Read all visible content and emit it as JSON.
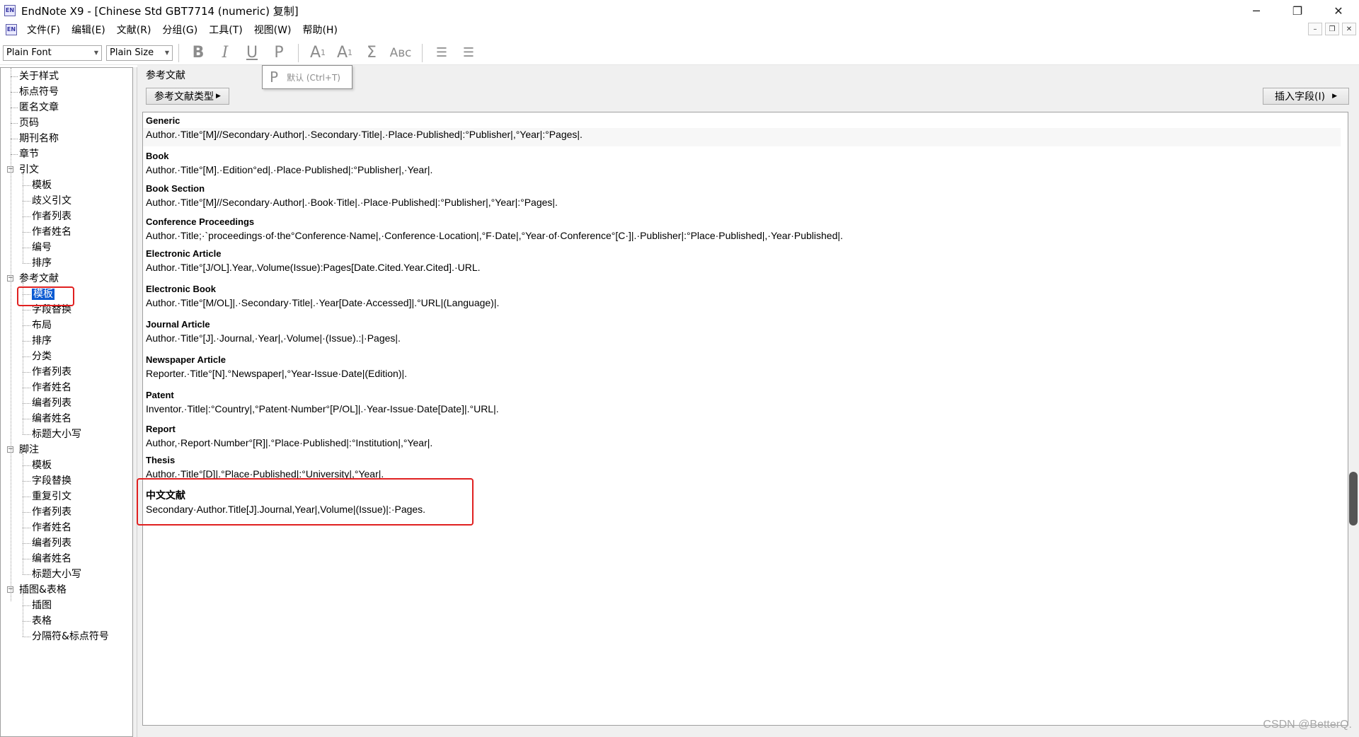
{
  "window": {
    "app_icon": "EN",
    "title": "EndNote X9 - [Chinese Std GBT7714 (numeric) 复制]"
  },
  "menu": {
    "items": [
      "文件(F)",
      "编辑(E)",
      "文献(R)",
      "分组(G)",
      "工具(T)",
      "视图(W)",
      "帮助(H)"
    ]
  },
  "toolbar": {
    "font_combo": "Plain Font",
    "size_combo": "Plain Size",
    "bold": "B",
    "italic": "I",
    "underline": "U",
    "plain": "P",
    "superscript": "A",
    "superscript_mark": "1",
    "subscript": "A",
    "subscript_mark": "1",
    "symbol": "Σ",
    "small_caps": "Aʙᴄ",
    "tooltip_icon": "P",
    "tooltip_text": "默认 (Ctrl+T)"
  },
  "tree": {
    "items": [
      "关于样式",
      "标点符号",
      "匿名文章",
      "页码",
      "期刊名称",
      "章节",
      "引文",
      "模板",
      "歧义引文",
      "作者列表",
      "作者姓名",
      "编号",
      "排序",
      "参考文献",
      "模板",
      "字段替换",
      "布局",
      "排序",
      "分类",
      "作者列表",
      "作者姓名",
      "编者列表",
      "编者姓名",
      "标题大小写",
      "脚注",
      "模板",
      "字段替换",
      "重复引文",
      "作者列表",
      "作者姓名",
      "编者列表",
      "编者姓名",
      "标题大小写",
      "插图&表格",
      "插图",
      "表格",
      "分隔符&标点符号"
    ]
  },
  "main": {
    "section_title": "参考文献",
    "ref_type_button": "参考文献类型",
    "insert_field_button": "插入字段(I)",
    "entries": [
      {
        "type": "Generic",
        "template": "Author.·Title°[M]//Secondary·Author|.·Secondary·Title|.·Place·Published|:°Publisher|,°Year|:°Pages|."
      },
      {
        "type": "Book",
        "template": "Author.·Title°[M].·Edition°ed|.·Place·Published|:°Publisher|,·Year|."
      },
      {
        "type": "Book Section",
        "template": "Author.·Title°[M]//Secondary·Author|.·Book·Title|.·Place·Published|:°Publisher|,°Year|:°Pages|."
      },
      {
        "type": "Conference Proceedings",
        "template": "Author.·Title;·`proceedings·of·the°Conference·Name|,·Conference·Location|,°F·Date|,°Year·of·Conference°[C·]|.·Publisher|:°Place·Published|,·Year·Published|."
      },
      {
        "type": "Electronic Article",
        "template": "Author.·Title°[J/OL].Year,.Volume(Issue):Pages[Date.Cited.Year.Cited].·URL."
      },
      {
        "type": "Electronic Book",
        "template": "Author.·Title°[M/OL]|.·Secondary·Title|.·Year[Date·Accessed]|.°URL|(Language)|."
      },
      {
        "type": "Journal Article",
        "template": "Author.·Title°[J].·Journal,·Year|,·Volume|·(Issue).:|·Pages|."
      },
      {
        "type": "Newspaper Article",
        "template": "Reporter.·Title°[N].°Newspaper|,°Year-Issue·Date|(Edition)|."
      },
      {
        "type": "Patent",
        "template": "Inventor.·Title|:°Country|,°Patent·Number°[P/OL]|.·Year-Issue·Date[Date]|.°URL|."
      },
      {
        "type": "Report",
        "template": "Author,·Report·Number°[R]|.°Place·Published|:°Institution|,°Year|."
      },
      {
        "type": "Thesis",
        "template": "Author.·Title°[D]|.°Place·Published|:°University|,°Year|."
      },
      {
        "type": "中文文献",
        "template": "Secondary·Author.Title[J].Journal,Year|,Volume|(Issue)|:·Pages."
      }
    ]
  },
  "watermark": "CSDN @BetterQ.",
  "colors": {
    "selection": "#0a5ad2",
    "highlight_box": "#e02020",
    "toolbar_icon": "#8c8c8c"
  }
}
